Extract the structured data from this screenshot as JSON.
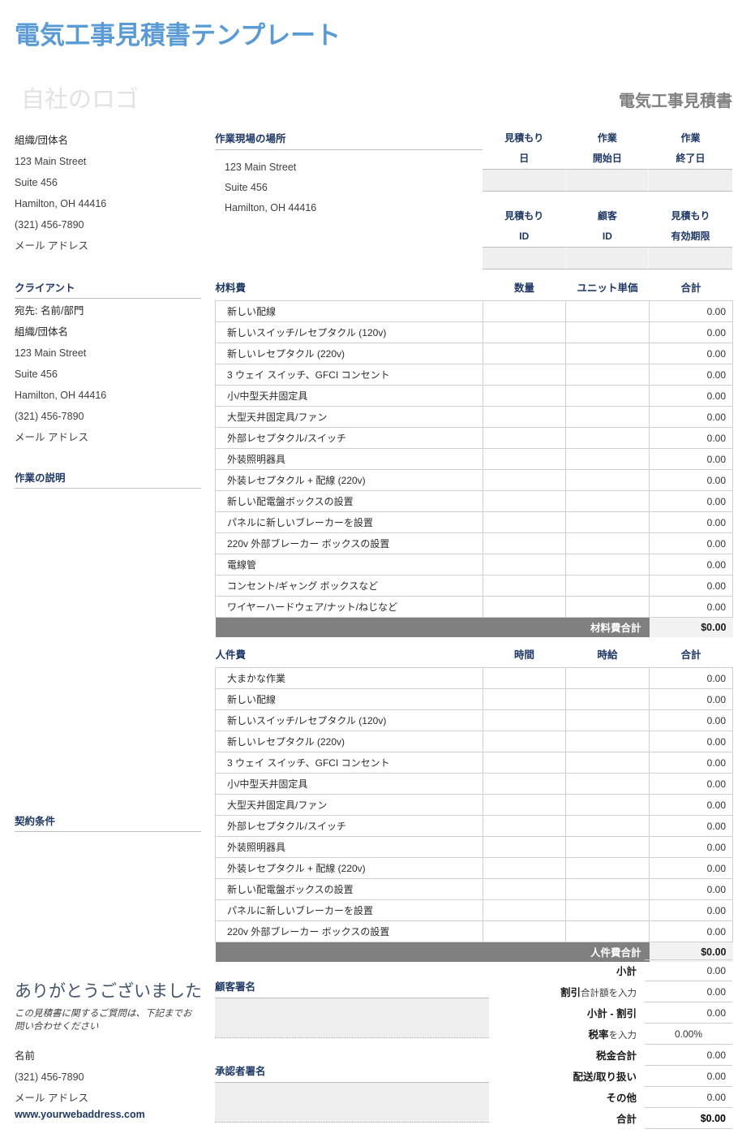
{
  "doc": {
    "title": "電気工事見積書テンプレート",
    "logo_placeholder": "自社のロゴ",
    "kind": "電気工事見積書"
  },
  "company": {
    "lines": [
      "組織/団体名",
      "123 Main Street",
      "Suite 456",
      "Hamilton, OH 44416",
      "(321) 456-7890",
      "メール アドレス"
    ]
  },
  "client": {
    "heading": "クライアント",
    "lines": [
      "宛先: 名前/部門",
      "組織/団体名",
      "123 Main Street",
      "Suite 456",
      "Hamilton, OH 44416",
      "(321) 456-7890",
      "メール アドレス"
    ]
  },
  "work_description": {
    "heading": "作業の説明"
  },
  "terms": {
    "heading": "契約条件"
  },
  "worksite": {
    "heading": "作業現場の場所",
    "lines": [
      "123 Main Street",
      "Suite 456",
      "Hamilton, OH 44416"
    ]
  },
  "meta": {
    "row1": [
      {
        "line1": "見積もり",
        "line2": "日",
        "value": ""
      },
      {
        "line1": "作業",
        "line2": "開始日",
        "value": ""
      },
      {
        "line1": "作業",
        "line2": "終了日",
        "value": ""
      }
    ],
    "row2": [
      {
        "line1": "見積もり",
        "line2": "ID",
        "value": ""
      },
      {
        "line1": "顧客",
        "line2": "ID",
        "value": ""
      },
      {
        "line1": "見積もり",
        "line2": "有効期限",
        "value": ""
      }
    ]
  },
  "materials": {
    "headers": [
      "材料費",
      "数量",
      "ユニット単価",
      "合計"
    ],
    "rows": [
      {
        "desc": "新しい配線",
        "qty": "",
        "unit": "",
        "total": "0.00"
      },
      {
        "desc": "新しいスイッチ/レセプタクル (120v)",
        "qty": "",
        "unit": "",
        "total": "0.00"
      },
      {
        "desc": "新しいレセプタクル (220v)",
        "qty": "",
        "unit": "",
        "total": "0.00"
      },
      {
        "desc": "3 ウェイ スイッチ、GFCI コンセント",
        "qty": "",
        "unit": "",
        "total": "0.00"
      },
      {
        "desc": "小/中型天井固定具",
        "qty": "",
        "unit": "",
        "total": "0.00"
      },
      {
        "desc": "大型天井固定具/ファン",
        "qty": "",
        "unit": "",
        "total": "0.00"
      },
      {
        "desc": "外部レセプタクル/スイッチ",
        "qty": "",
        "unit": "",
        "total": "0.00"
      },
      {
        "desc": "外装照明器具",
        "qty": "",
        "unit": "",
        "total": "0.00"
      },
      {
        "desc": "外装レセプタクル + 配線 (220v)",
        "qty": "",
        "unit": "",
        "total": "0.00"
      },
      {
        "desc": "新しい配電盤ボックスの設置",
        "qty": "",
        "unit": "",
        "total": "0.00"
      },
      {
        "desc": "パネルに新しいブレーカーを設置",
        "qty": "",
        "unit": "",
        "total": "0.00"
      },
      {
        "desc": "220v 外部ブレーカー ボックスの設置",
        "qty": "",
        "unit": "",
        "total": "0.00"
      },
      {
        "desc": "電線管",
        "qty": "",
        "unit": "",
        "total": "0.00"
      },
      {
        "desc": "コンセント/ギャング ボックスなど",
        "qty": "",
        "unit": "",
        "total": "0.00"
      },
      {
        "desc": "ワイヤーハードウェア/ナット/ねじなど",
        "qty": "",
        "unit": "",
        "total": "0.00"
      }
    ],
    "total_label": "材料費合計",
    "total_value": "$0.00"
  },
  "labor": {
    "headers": [
      "人件費",
      "時間",
      "時給",
      "合計"
    ],
    "rows": [
      {
        "desc": "大まかな作業",
        "qty": "",
        "unit": "",
        "total": "0.00"
      },
      {
        "desc": "新しい配線",
        "qty": "",
        "unit": "",
        "total": "0.00"
      },
      {
        "desc": "新しいスイッチ/レセプタクル (120v)",
        "qty": "",
        "unit": "",
        "total": "0.00"
      },
      {
        "desc": "新しいレセプタクル (220v)",
        "qty": "",
        "unit": "",
        "total": "0.00"
      },
      {
        "desc": "3 ウェイ スイッチ、GFCI コンセント",
        "qty": "",
        "unit": "",
        "total": "0.00"
      },
      {
        "desc": "小/中型天井固定具",
        "qty": "",
        "unit": "",
        "total": "0.00"
      },
      {
        "desc": "大型天井固定具/ファン",
        "qty": "",
        "unit": "",
        "total": "0.00"
      },
      {
        "desc": "外部レセプタクル/スイッチ",
        "qty": "",
        "unit": "",
        "total": "0.00"
      },
      {
        "desc": "外装照明器具",
        "qty": "",
        "unit": "",
        "total": "0.00"
      },
      {
        "desc": "外装レセプタクル + 配線 (220v)",
        "qty": "",
        "unit": "",
        "total": "0.00"
      },
      {
        "desc": "新しい配電盤ボックスの設置",
        "qty": "",
        "unit": "",
        "total": "0.00"
      },
      {
        "desc": "パネルに新しいブレーカーを設置",
        "qty": "",
        "unit": "",
        "total": "0.00"
      },
      {
        "desc": "220v 外部ブレーカー ボックスの設置",
        "qty": "",
        "unit": "",
        "total": "0.00"
      }
    ],
    "total_label": "人件費合計",
    "total_value": "$0.00"
  },
  "summary": {
    "rows": [
      {
        "label": "小計",
        "hint": "",
        "value": "0.00",
        "center": false,
        "grand": false
      },
      {
        "label": "割引",
        "hint": "合計額を入力",
        "value": "0.00",
        "center": false,
        "grand": false
      },
      {
        "label": "小計 - 割引",
        "hint": "",
        "value": "0.00",
        "center": false,
        "grand": false
      },
      {
        "label": "税率",
        "hint": "を入力",
        "value": "0.00%",
        "center": true,
        "grand": false
      },
      {
        "label": "税金合計",
        "hint": "",
        "value": "0.00",
        "center": false,
        "grand": false
      },
      {
        "label": "配送/取り扱い",
        "hint": "",
        "value": "0.00",
        "center": false,
        "grand": false
      },
      {
        "label": "その他",
        "hint": "",
        "value": "0.00",
        "center": false,
        "grand": false
      },
      {
        "label": "合計",
        "hint": "",
        "value": "$0.00",
        "center": false,
        "grand": true
      }
    ]
  },
  "signatures": {
    "customer_heading": "顧客署名",
    "approver_heading": "承認者署名"
  },
  "footer": {
    "thanks": "ありがとうございました",
    "note": "この見積書に関するご質問は、下記までお問い合わせください",
    "contact": [
      "名前",
      "(321) 456-7890",
      "メール アドレス"
    ],
    "url": "www.yourwebaddress.com"
  }
}
